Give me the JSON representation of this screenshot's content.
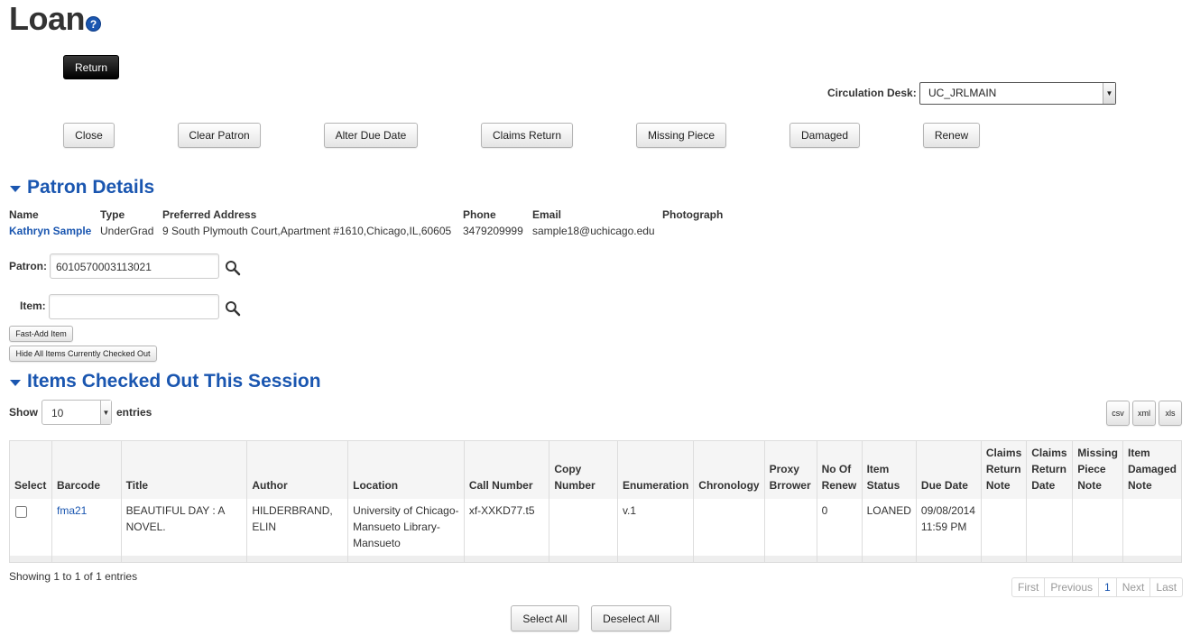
{
  "page": {
    "title": "Loan",
    "help_glyph": "?"
  },
  "actions": {
    "return_label": "Return"
  },
  "circulation_desk": {
    "label": "Circulation Desk:",
    "value": "UC_JRLMAIN"
  },
  "toolbar": {
    "close": "Close",
    "clear_patron": "Clear Patron",
    "alter_due_date": "Alter Due Date",
    "claims_return": "Claims Return",
    "missing_piece": "Missing Piece",
    "damaged": "Damaged",
    "renew": "Renew"
  },
  "patron_details": {
    "title": "Patron Details",
    "headers": {
      "name": "Name",
      "type": "Type",
      "address": "Preferred Address",
      "phone": "Phone",
      "email": "Email",
      "photograph": "Photograph"
    },
    "name": "Kathryn Sample",
    "type": "UnderGrad",
    "address": "9 South Plymouth Court,Apartment #1610,Chicago,IL,60605",
    "phone": "3479209999",
    "email": "sample18@uchicago.edu"
  },
  "patron_field": {
    "label": "Patron:",
    "value": "6010570003113021"
  },
  "item_field": {
    "label": "Item:",
    "value": ""
  },
  "fast_add_label": "Fast-Add Item",
  "hide_items_label": "Hide All Items Currently Checked Out",
  "items_section": {
    "title": "Items Checked Out This Session",
    "show_label": "Show",
    "entries_value": "10",
    "entries_label": "entries",
    "export": {
      "csv": "csv",
      "xml": "xml",
      "xls": "xls"
    },
    "columns": {
      "select": "Select",
      "barcode": "Barcode",
      "title": "Title",
      "author": "Author",
      "location": "Location",
      "call_number": "Call Number",
      "copy_number": "Copy Number",
      "enumeration": "Enumeration",
      "chronology": "Chronology",
      "proxy_borrower": "Proxy Brrower",
      "no_of_renew": "No Of Renew",
      "item_status": "Item Status",
      "due_date": "Due Date",
      "claims_return_note": "Claims Return Note",
      "claims_return_date": "Claims Return Date",
      "missing_piece_note": "Missing Piece Note",
      "item_damaged_note": "Item Damaged Note"
    },
    "rows": [
      {
        "barcode": "fma21",
        "title": "BEAUTIFUL DAY : A NOVEL.",
        "author": "HILDERBRAND, ELIN",
        "location": "University of Chicago-Mansueto Library-Mansueto",
        "call_number": "xf-XXKD77.t5",
        "copy_number": "",
        "enumeration": "v.1",
        "chronology": "",
        "proxy_borrower": "",
        "no_of_renew": "0",
        "item_status": "LOANED",
        "due_date": "09/08/2014 11:59 PM",
        "claims_return_note": "",
        "claims_return_date": "",
        "missing_piece_note": "",
        "item_damaged_note": ""
      }
    ],
    "info": "Showing 1 to 1 of 1 entries",
    "pagination": {
      "first": "First",
      "previous": "Previous",
      "current": "1",
      "next": "Next",
      "last": "Last"
    }
  },
  "footer_buttons": {
    "select_all": "Select All",
    "deselect_all": "Deselect All"
  },
  "colors": {
    "accent": "#1a56b0",
    "dark_button": "#111111"
  }
}
